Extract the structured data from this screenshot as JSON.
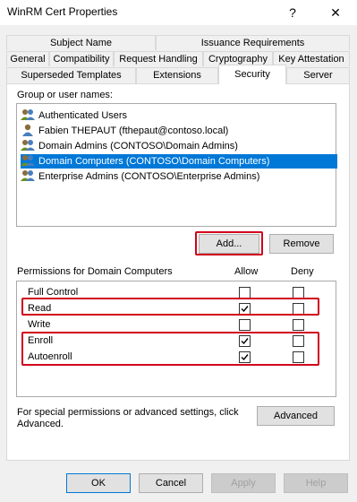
{
  "window": {
    "title": "WinRM Cert Properties",
    "help_glyph": "?",
    "close_glyph": "✕"
  },
  "tabs": {
    "row1": [
      {
        "label": "Subject Name"
      },
      {
        "label": "Issuance Requirements"
      }
    ],
    "row2": [
      {
        "label": "General"
      },
      {
        "label": "Compatibility"
      },
      {
        "label": "Request Handling"
      },
      {
        "label": "Cryptography"
      },
      {
        "label": "Key Attestation"
      }
    ],
    "row3": [
      {
        "label": "Superseded Templates"
      },
      {
        "label": "Extensions"
      },
      {
        "label": "Security",
        "active": true
      },
      {
        "label": "Server"
      }
    ]
  },
  "security": {
    "group_label": "Group or user names:",
    "users": [
      {
        "name": "Authenticated Users",
        "icon": "group-icon"
      },
      {
        "name": "Fabien THEPAUT (fthepaut@contoso.local)",
        "icon": "user-icon"
      },
      {
        "name": "Domain Admins (CONTOSO\\Domain Admins)",
        "icon": "group-icon"
      },
      {
        "name": "Domain Computers (CONTOSO\\Domain Computers)",
        "icon": "group-icon",
        "selected": true
      },
      {
        "name": "Enterprise Admins (CONTOSO\\Enterprise Admins)",
        "icon": "group-icon"
      }
    ],
    "add_label": "Add...",
    "remove_label": "Remove",
    "permissions_label": "Permissions for Domain Computers",
    "allow_header": "Allow",
    "deny_header": "Deny",
    "permissions": [
      {
        "name": "Full Control",
        "allow": false,
        "deny": false
      },
      {
        "name": "Read",
        "allow": true,
        "deny": false
      },
      {
        "name": "Write",
        "allow": false,
        "deny": false
      },
      {
        "name": "Enroll",
        "allow": true,
        "deny": false
      },
      {
        "name": "Autoenroll",
        "allow": true,
        "deny": false
      }
    ],
    "special_text_line1": "For special permissions or advanced settings, click",
    "special_text_line2": "Advanced.",
    "advanced_label": "Advanced"
  },
  "footer": {
    "ok_label": "OK",
    "cancel_label": "Cancel",
    "apply_label": "Apply",
    "help_label": "Help"
  },
  "colors": {
    "selection": "#0078d7",
    "highlight_box": "#d0021b"
  }
}
